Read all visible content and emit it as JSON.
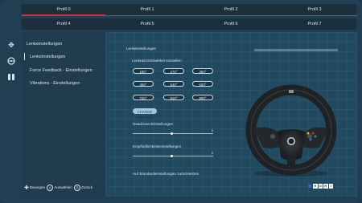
{
  "profiles": [
    {
      "label": "Profil 0"
    },
    {
      "label": "Profil 1"
    },
    {
      "label": "Profil 2"
    },
    {
      "label": "Profil 3"
    },
    {
      "label": "Profil 4"
    },
    {
      "label": "Profil 5"
    },
    {
      "label": "Profil 6"
    },
    {
      "label": "Profil 7"
    }
  ],
  "menu": {
    "title": "Lenkeinstellungen",
    "items": [
      {
        "label": "Lenkeinstellungen"
      },
      {
        "label": "Force Feedback - Einstellungen"
      },
      {
        "label": "Vibrations - Einstellungen"
      }
    ]
  },
  "hints": {
    "move": "Bewegen",
    "select_key": "A",
    "select": "Auswählen",
    "back_key": "B",
    "back": "Zurück"
  },
  "panel": {
    "title": "Lenkeinstellungen",
    "angle_label": "Lenkrad-Drehwinkel einstellen",
    "angles": [
      "180°",
      "270°",
      "360°",
      "450°",
      "540°",
      "630°",
      "720°",
      "810°",
      "900°"
    ],
    "standard_button": "CHANGE SETTING",
    "deadzone_label": "Deadzone-Einstellungen",
    "deadzone_value": "0",
    "sensitivity_label": "Empfindlichkeitseinstellungen",
    "sensitivity_value": "0",
    "reset_label": "Auf Standardeinstellungen zurücksetzen"
  },
  "brand": {
    "letters": [
      "H",
      "O",
      "R",
      "I"
    ]
  },
  "colors": {
    "accent": "#d1333b",
    "panel": "#21495f",
    "menu": "#203c4e"
  }
}
